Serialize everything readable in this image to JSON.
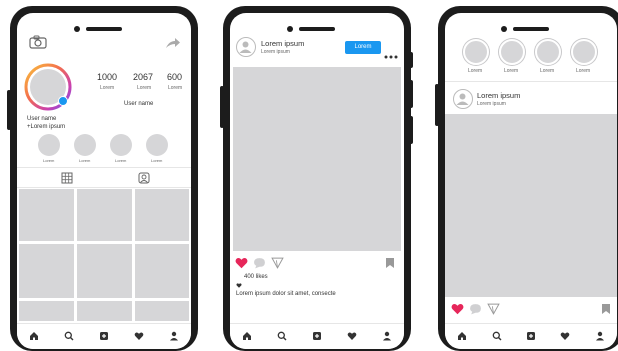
{
  "phone1": {
    "stats": [
      {
        "value": "1000",
        "label": "Lorem"
      },
      {
        "value": "2067",
        "label": "Lorem"
      },
      {
        "value": "600",
        "label": "Lorem"
      }
    ],
    "username_right": "User name",
    "username_left": "User name",
    "bio": "+Lorem ipsum",
    "highlights": [
      "Lorem",
      "Lorem",
      "Lorem",
      "Lorem"
    ]
  },
  "phone2": {
    "author": "Lorem ipsum",
    "subtitle": "Lorem ipsum",
    "follow_label": "Lorem",
    "likes": "400 likes",
    "caption": "Lorem ipsum dolor sit amet, consecte"
  },
  "phone3": {
    "stories": [
      "Lorem",
      "Lorem",
      "Lorem",
      "Lorem"
    ],
    "author": "Lorem ipsum",
    "subtitle": "Lorem ipsum"
  },
  "colors": {
    "accent_blue": "#1a97f0",
    "like_red": "#e6265a",
    "placeholder": "#d6d6d8",
    "ring_gradient": [
      "#f9c23c",
      "#f36f4d",
      "#c93fb0",
      "#6a5cf0"
    ]
  },
  "icons": [
    "camera-icon",
    "share-icon",
    "grid-icon",
    "tag-user-icon",
    "more-icon",
    "heart-icon",
    "comment-icon",
    "send-icon",
    "bookmark-icon",
    "home-icon",
    "search-icon",
    "add-icon",
    "activity-icon",
    "profile-icon"
  ]
}
